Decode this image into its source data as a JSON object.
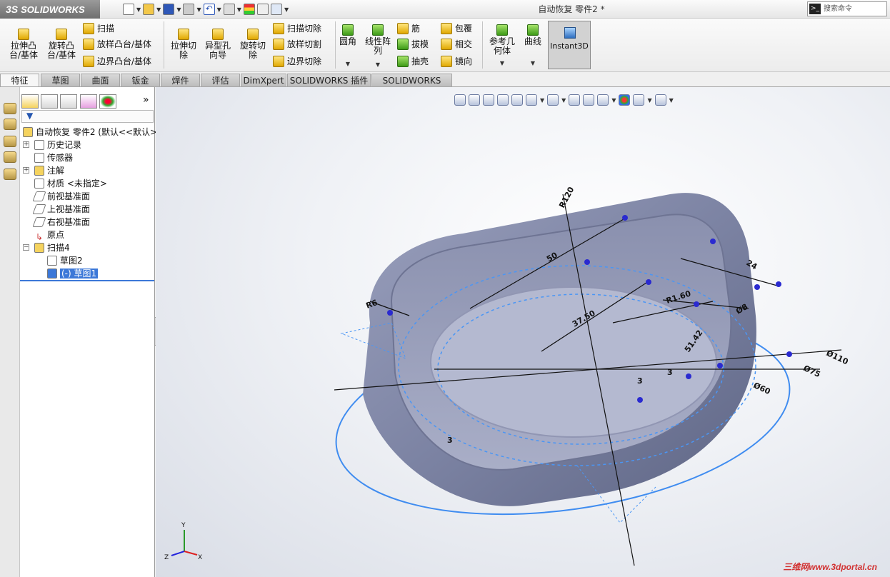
{
  "app": {
    "logo": "SOLIDWORKS",
    "doc_title": "自动恢复 零件2 *",
    "search_placeholder": "搜索命令"
  },
  "ribbon": {
    "extrude_boss": "拉伸凸\n台/基体",
    "revolve_boss": "旋转凸\n台/基体",
    "sweep": "扫描",
    "loft": "放样凸台/基体",
    "boundary": "边界凸台/基体",
    "extrude_cut": "拉伸切\n除",
    "hole_wizard": "异型孔\n向导",
    "revolve_cut": "旋转切\n除",
    "swept_cut": "扫描切除",
    "lofted_cut": "放样切割",
    "boundary_cut": "边界切除",
    "fillet": "圆角",
    "linear_pattern": "线性阵\n列",
    "rib": "筋",
    "draft": "拔模",
    "shell": "抽壳",
    "wrap": "包覆",
    "intersect": "相交",
    "mirror": "镜向",
    "ref_geometry": "参考几\n何体",
    "curves": "曲线",
    "instant3d": "Instant3D"
  },
  "tabs": [
    "特征",
    "草图",
    "曲面",
    "钣金",
    "焊件",
    "评估",
    "DimXpert",
    "SOLIDWORKS 插件",
    "SOLIDWORKS MBD"
  ],
  "tree": {
    "root": "自动恢复 零件2 (默认<<默认>",
    "items": [
      "历史记录",
      "传感器",
      "注解",
      "材质 <未指定>",
      "前视基准面",
      "上视基准面",
      "右视基准面",
      "原点",
      "扫描4",
      "草图2",
      "(-) 草图1"
    ]
  },
  "dims": [
    "R120",
    "50",
    "R6",
    "37.50",
    "R1.60",
    "24",
    "Ø8",
    "51.42",
    "Ø110",
    "Ø75",
    "Ø60",
    "3",
    "3",
    "3"
  ],
  "triad": {
    "x": "X",
    "y": "Y",
    "z": "Z"
  },
  "watermark": "三维网www.3dportal.cn",
  "colors": {
    "sketch": "#3f8cf0",
    "dim": "#111111",
    "model": "#7f86a6",
    "dot": "#2a2ad0"
  }
}
